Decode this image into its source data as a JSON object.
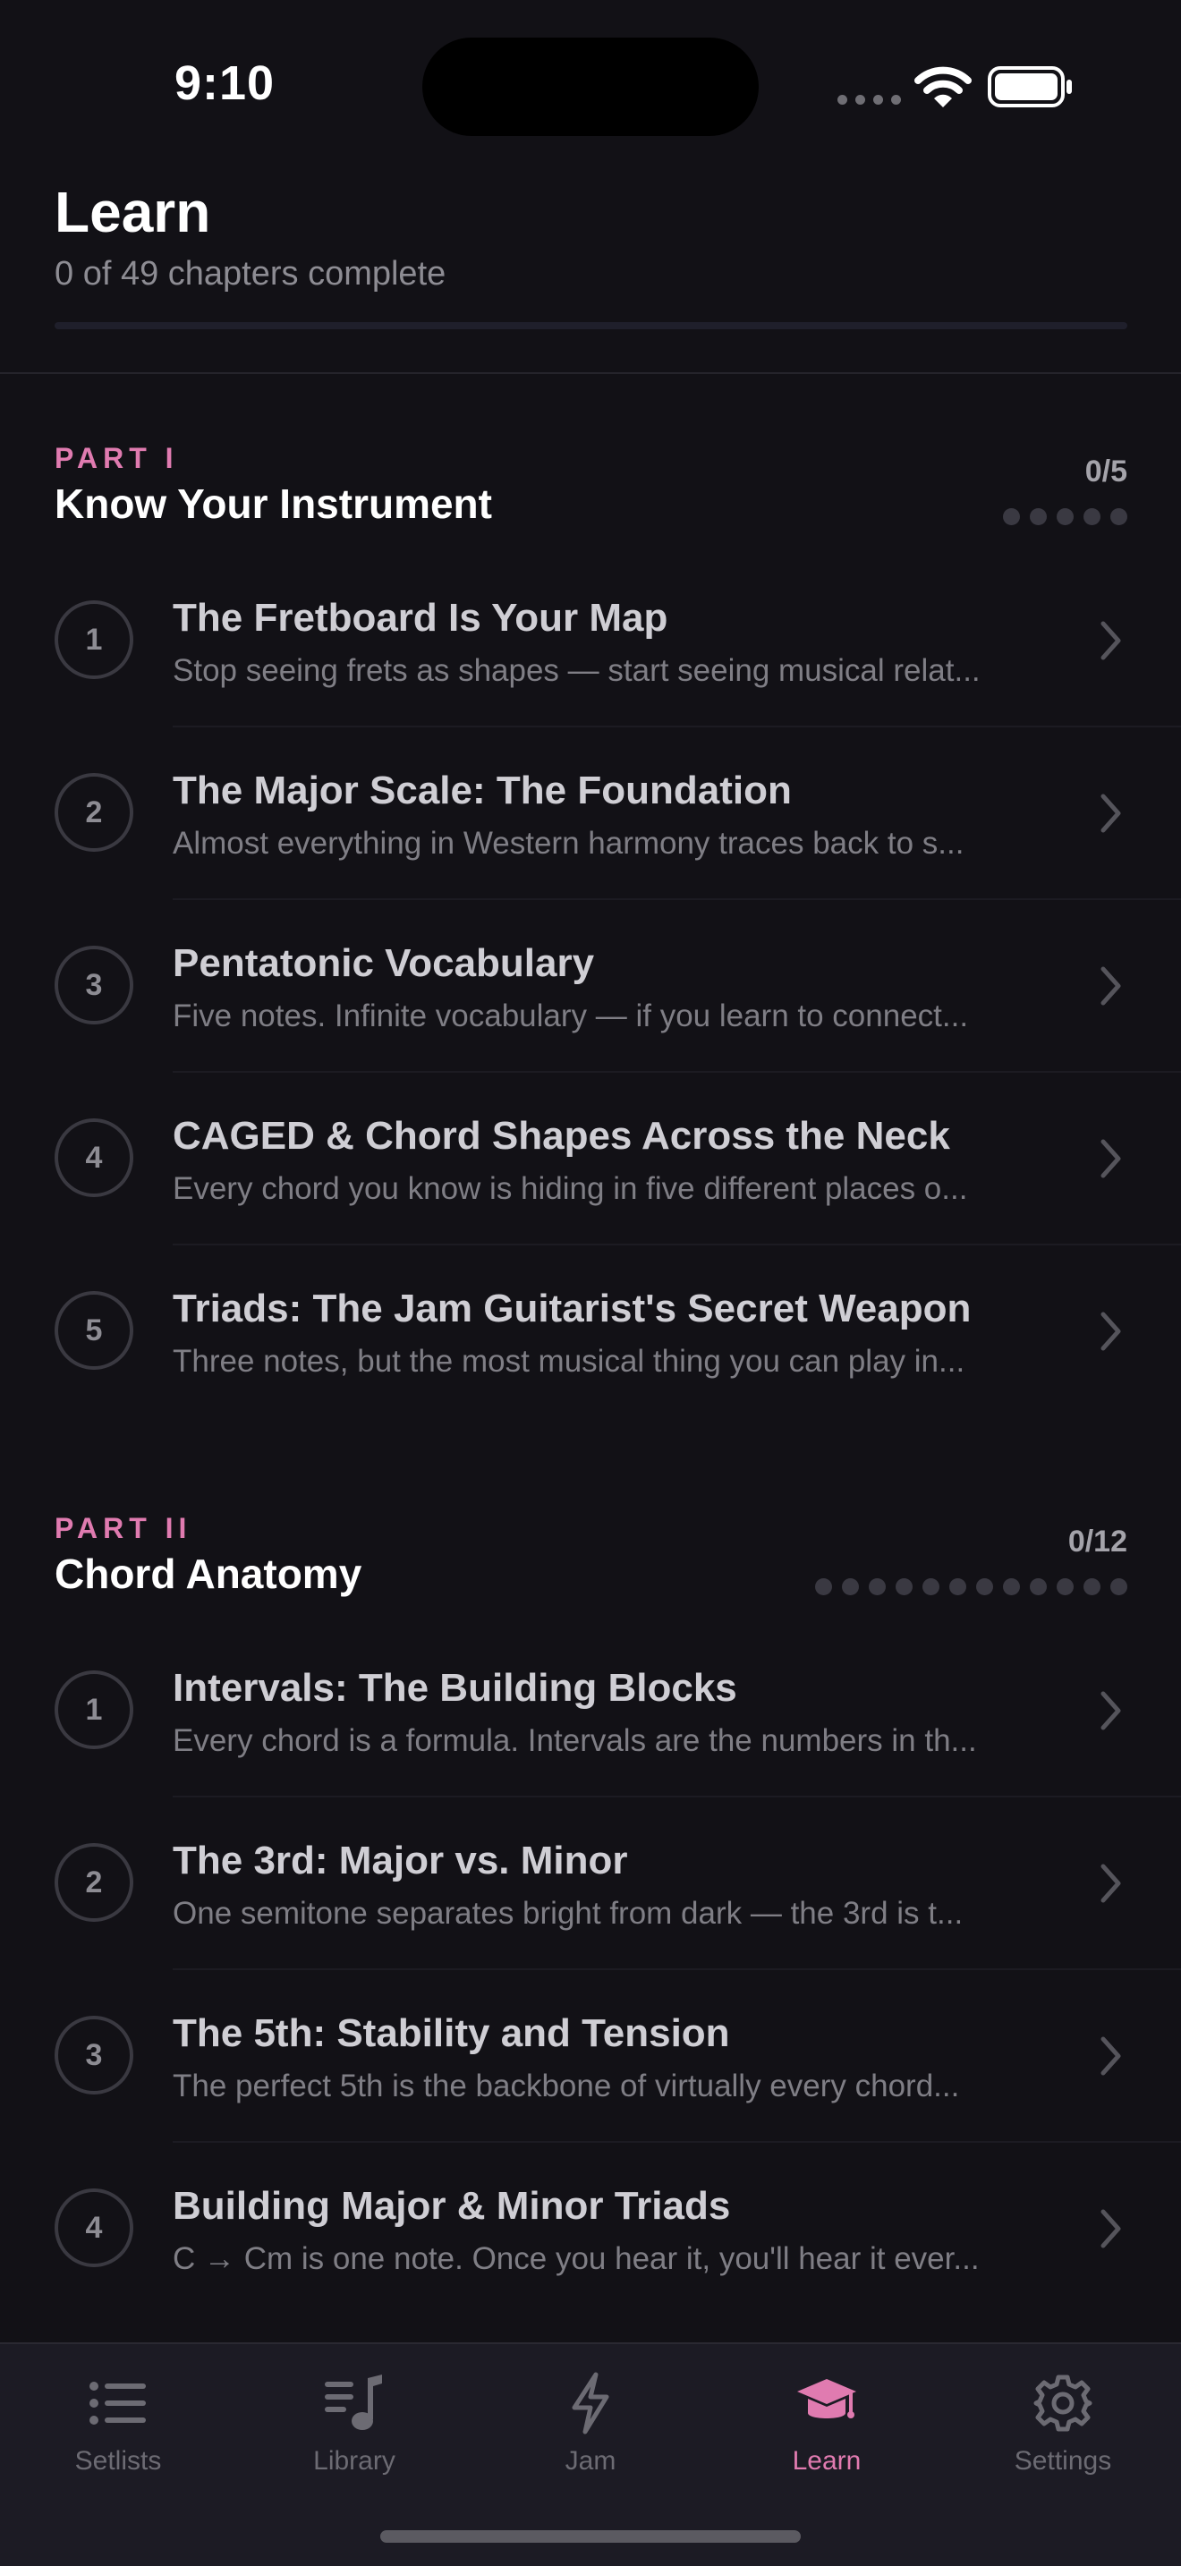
{
  "status_bar": {
    "time": "9:10"
  },
  "header": {
    "title": "Learn",
    "progress_text": "0 of 49 chapters complete",
    "progress_fraction": 0
  },
  "colors": {
    "accent": "#e07bb0",
    "background": "#121116",
    "tab_bar": "#1c1b24"
  },
  "sections": [
    {
      "part_label": "PART I",
      "title": "Know Your Instrument",
      "count": "0/5",
      "total": 5,
      "chapters": [
        {
          "num": "1",
          "title": "The Fretboard Is Your Map",
          "subtitle": "Stop seeing frets as shapes — start seeing musical relat..."
        },
        {
          "num": "2",
          "title": "The Major Scale: The Foundation",
          "subtitle": "Almost everything in Western harmony traces back to s..."
        },
        {
          "num": "3",
          "title": "Pentatonic Vocabulary",
          "subtitle": "Five notes. Infinite vocabulary — if you learn to connect..."
        },
        {
          "num": "4",
          "title": "CAGED & Chord Shapes Across the Neck",
          "subtitle": "Every chord you know is hiding in five different places o..."
        },
        {
          "num": "5",
          "title": "Triads: The Jam Guitarist's Secret Weapon",
          "subtitle": "Three notes, but the most musical thing you can play in..."
        }
      ]
    },
    {
      "part_label": "PART II",
      "title": "Chord Anatomy",
      "count": "0/12",
      "total": 12,
      "chapters": [
        {
          "num": "1",
          "title": "Intervals: The Building Blocks",
          "subtitle": "Every chord is a formula. Intervals are the numbers in th..."
        },
        {
          "num": "2",
          "title": "The 3rd: Major vs. Minor",
          "subtitle": "One semitone separates bright from dark — the 3rd is t..."
        },
        {
          "num": "3",
          "title": "The 5th: Stability and Tension",
          "subtitle": "The perfect 5th is the backbone of virtually every chord..."
        },
        {
          "num": "4",
          "title": "Building Major & Minor Triads",
          "subtitle": "C → Cm is one note. Once you hear it, you'll hear it ever..."
        }
      ]
    }
  ],
  "tabs": [
    {
      "label": "Setlists",
      "icon": "list-icon",
      "active": false
    },
    {
      "label": "Library",
      "icon": "music-note-list-icon",
      "active": false
    },
    {
      "label": "Jam",
      "icon": "bolt-icon",
      "active": false
    },
    {
      "label": "Learn",
      "icon": "graduation-cap-icon",
      "active": true
    },
    {
      "label": "Settings",
      "icon": "gear-icon",
      "active": false
    }
  ]
}
